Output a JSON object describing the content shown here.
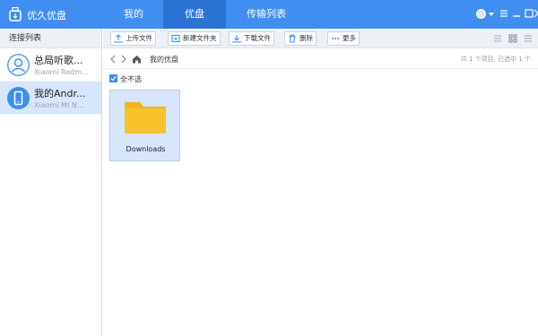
{
  "app": {
    "title": "优久优盘"
  },
  "tabs": [
    {
      "label": "我的"
    },
    {
      "label": "优盘"
    },
    {
      "label": "传输列表"
    }
  ],
  "sidebar": {
    "header": "连接列表",
    "devices": [
      {
        "name": "总局听歌...",
        "subtitle": "Xiaomi Redm..."
      },
      {
        "name": "我的Andr...",
        "subtitle": "Xiaomi MI N..."
      }
    ]
  },
  "toolbar": {
    "upload": "上传文件",
    "new_folder": "新建文件夹",
    "download": "下载文件",
    "delete": "删除",
    "more": "更多"
  },
  "path": {
    "current": "我的优盘",
    "status": "共 1 个项目, 已选中 1 个"
  },
  "selection": {
    "select_all_label": "全不选"
  },
  "files": [
    {
      "name": "Downloads"
    }
  ],
  "colors": {
    "accent": "#3f8ef0",
    "active_tab": "#2c74d4",
    "selected_bg": "#d7e6fb",
    "folder": "#f8c22c"
  }
}
